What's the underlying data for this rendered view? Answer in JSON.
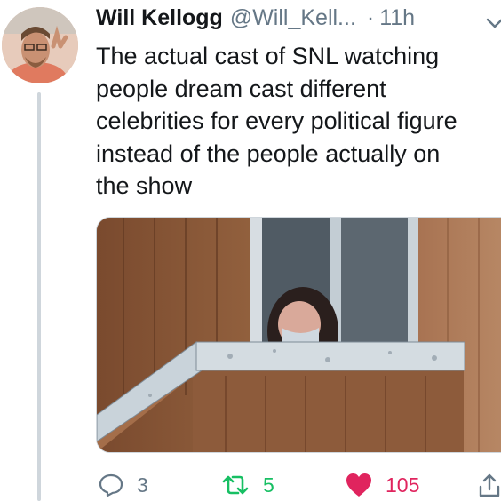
{
  "tweet": {
    "author_name": "Will Kellogg",
    "author_handle": "@Will_Kell...",
    "separator": "·",
    "time": "11h",
    "text": "The actual cast of SNL watching\npeople dream cast different\ncelebrities for every political figure\ninstead of the people actually on\nthe show"
  },
  "actions": {
    "reply_count": "3",
    "retweet_count": "5",
    "like_count": "105"
  },
  "icons": {
    "reply": "reply-icon",
    "retweet": "retweet-icon",
    "like": "heart-icon",
    "share": "share-icon",
    "menu": "chevron-down-icon"
  },
  "colors": {
    "text": "#14171a",
    "secondary": "#657786",
    "retweet": "#17bf63",
    "like": "#e0245e",
    "thread_line": "#cfd6dc"
  }
}
